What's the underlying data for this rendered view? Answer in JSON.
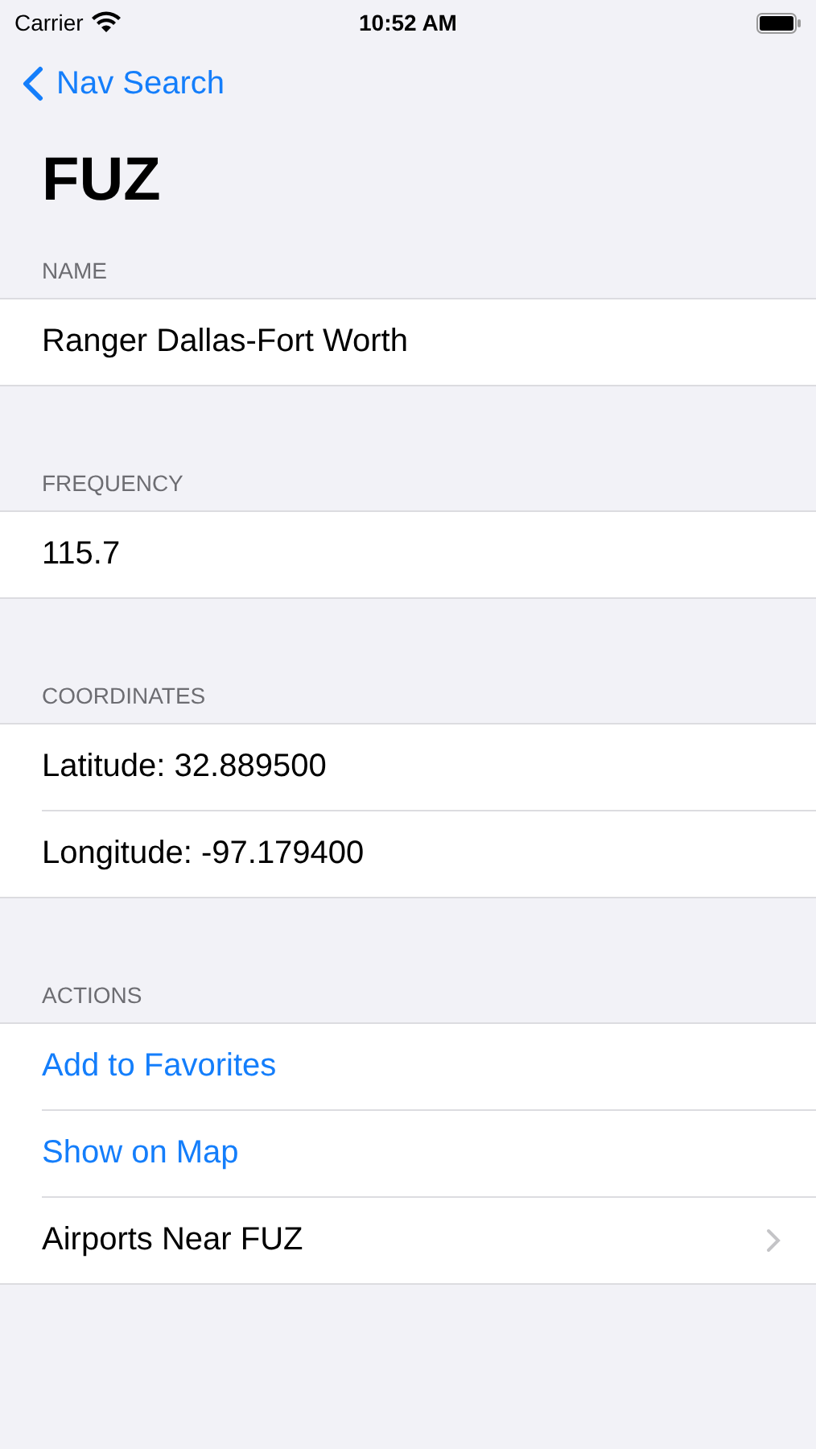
{
  "status_bar": {
    "carrier": "Carrier",
    "time": "10:52 AM"
  },
  "nav": {
    "back": "Nav Search",
    "title": "FUZ"
  },
  "sections": [
    {
      "header": "NAME",
      "rows": [
        {
          "text": "Ranger Dallas-Fort Worth",
          "kind": "plain"
        }
      ]
    },
    {
      "header": "FREQUENCY",
      "rows": [
        {
          "text": "115.7",
          "kind": "plain"
        }
      ]
    },
    {
      "header": "COORDINATES",
      "rows": [
        {
          "text": "Latitude: 32.889500",
          "kind": "plain"
        },
        {
          "text": "Longitude: -97.179400",
          "kind": "plain"
        }
      ]
    },
    {
      "header": "ACTIONS",
      "rows": [
        {
          "text": "Add to Favorites",
          "kind": "action"
        },
        {
          "text": "Show on Map",
          "kind": "action"
        },
        {
          "text": "Airports Near FUZ",
          "kind": "disclosure"
        }
      ]
    }
  ]
}
